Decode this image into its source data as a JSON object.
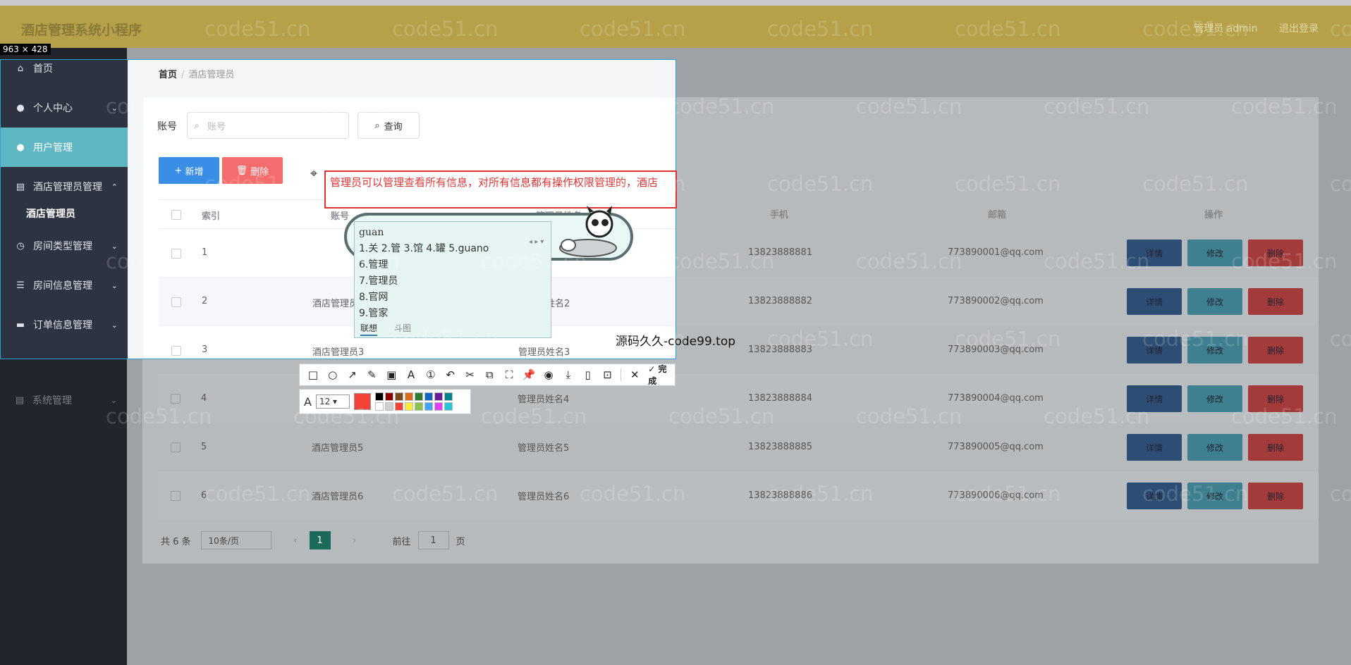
{
  "header": {
    "title": "酒店管理系统小程序",
    "admin": "管理员 admin",
    "logout": "退出登录"
  },
  "dims": "963 × 428",
  "sidebar": {
    "items": [
      {
        "label": "首页",
        "icon": "home-icon",
        "glyph": "⌂"
      },
      {
        "label": "个人中心",
        "icon": "user-icon",
        "glyph": "●"
      },
      {
        "label": "用户管理",
        "icon": "users-icon",
        "glyph": "●"
      },
      {
        "label": "酒店管理员管理",
        "icon": "clipboard-icon",
        "glyph": "▤"
      },
      {
        "label": "房间类型管理",
        "icon": "clock-icon",
        "glyph": "◷"
      },
      {
        "label": "房间信息管理",
        "icon": "list-icon",
        "glyph": "☰"
      },
      {
        "label": "订单信息管理",
        "icon": "order-icon",
        "glyph": "▬"
      },
      {
        "label": "系统管理",
        "icon": "settings-icon",
        "glyph": "▤"
      }
    ],
    "sub_item": "酒店管理员",
    "chevron": "⌄"
  },
  "breadcrumb": {
    "home": "首页",
    "sep": "/",
    "current": "酒店管理员"
  },
  "search": {
    "label": "账号",
    "placeholder": "账号",
    "button": "查询",
    "icon": "⌕"
  },
  "actions": {
    "add": "新增",
    "delete": "删除",
    "add_icon": "+",
    "delete_icon": "🗑"
  },
  "annotation": "管理员可以管理查看所有信息，对所有信息都有操作权限管理的，酒店",
  "table": {
    "headers": [
      "索引",
      "账号",
      "管理员姓名",
      "手机",
      "邮箱",
      "操作"
    ],
    "rows": [
      {
        "idx": "1",
        "account": "酒店管理员1",
        "name": "管理员姓名1",
        "phone": "13823888881",
        "email": "773890001@qq.com"
      },
      {
        "idx": "2",
        "account": "酒店管理员2",
        "name": "管理员姓名2",
        "phone": "13823888882",
        "email": "773890002@qq.com"
      },
      {
        "idx": "3",
        "account": "酒店管理员3",
        "name": "管理员姓名3",
        "phone": "13823888883",
        "email": "773890003@qq.com"
      },
      {
        "idx": "4",
        "account": "酒店管理员4",
        "name": "管理员姓名4",
        "phone": "13823888884",
        "email": "773890004@qq.com"
      },
      {
        "idx": "5",
        "account": "酒店管理员5",
        "name": "管理员姓名5",
        "phone": "13823888885",
        "email": "773890005@qq.com"
      },
      {
        "idx": "6",
        "account": "酒店管理员6",
        "name": "管理员姓名6",
        "phone": "13823888886",
        "email": "773890006@qq.com"
      }
    ],
    "op_labels": {
      "detail": "详情",
      "edit": "修改",
      "delete": "删除"
    }
  },
  "pager": {
    "total": "共 6 条",
    "size": "10条/页",
    "page": "1",
    "goto": "前往",
    "goto_value": "1",
    "unit": "页",
    "prev": "‹",
    "next": "›"
  },
  "ime": {
    "pinyin": "guan",
    "line1": "1.关  2.管  3.馆  4.罐  5.guano",
    "line2": "6.管理",
    "line3": "7.管理员",
    "line4": "8.官网",
    "line5": "9.管家",
    "tab1": "联想",
    "tab2": "斗图",
    "arrows": "◂ ▸ ▾"
  },
  "watermark_text": "源码久久-code99.top",
  "watermark": "code51.cn",
  "toolbar": {
    "tools": [
      "□",
      "○",
      "↗",
      "✎",
      "▣",
      "A",
      "①",
      "↶",
      "✂",
      "⧉",
      "⛶",
      "📌",
      "◉",
      "⤓",
      "▯",
      "⊡"
    ],
    "close": "✕",
    "done": "✓ 完成",
    "font_icon": "A",
    "font_size": "12",
    "selected_color": "#f44336",
    "palette": [
      "#000000",
      "#8b0000",
      "#7a4a1a",
      "#d96c1a",
      "#2e7d32",
      "#1565c0",
      "#6a1b9a",
      "#00838f",
      "#ffffff",
      "#cfcfcf",
      "#f44336",
      "#ffeb3b",
      "#8bc34a",
      "#42a5f5",
      "#e040fb",
      "#26c6da"
    ]
  }
}
